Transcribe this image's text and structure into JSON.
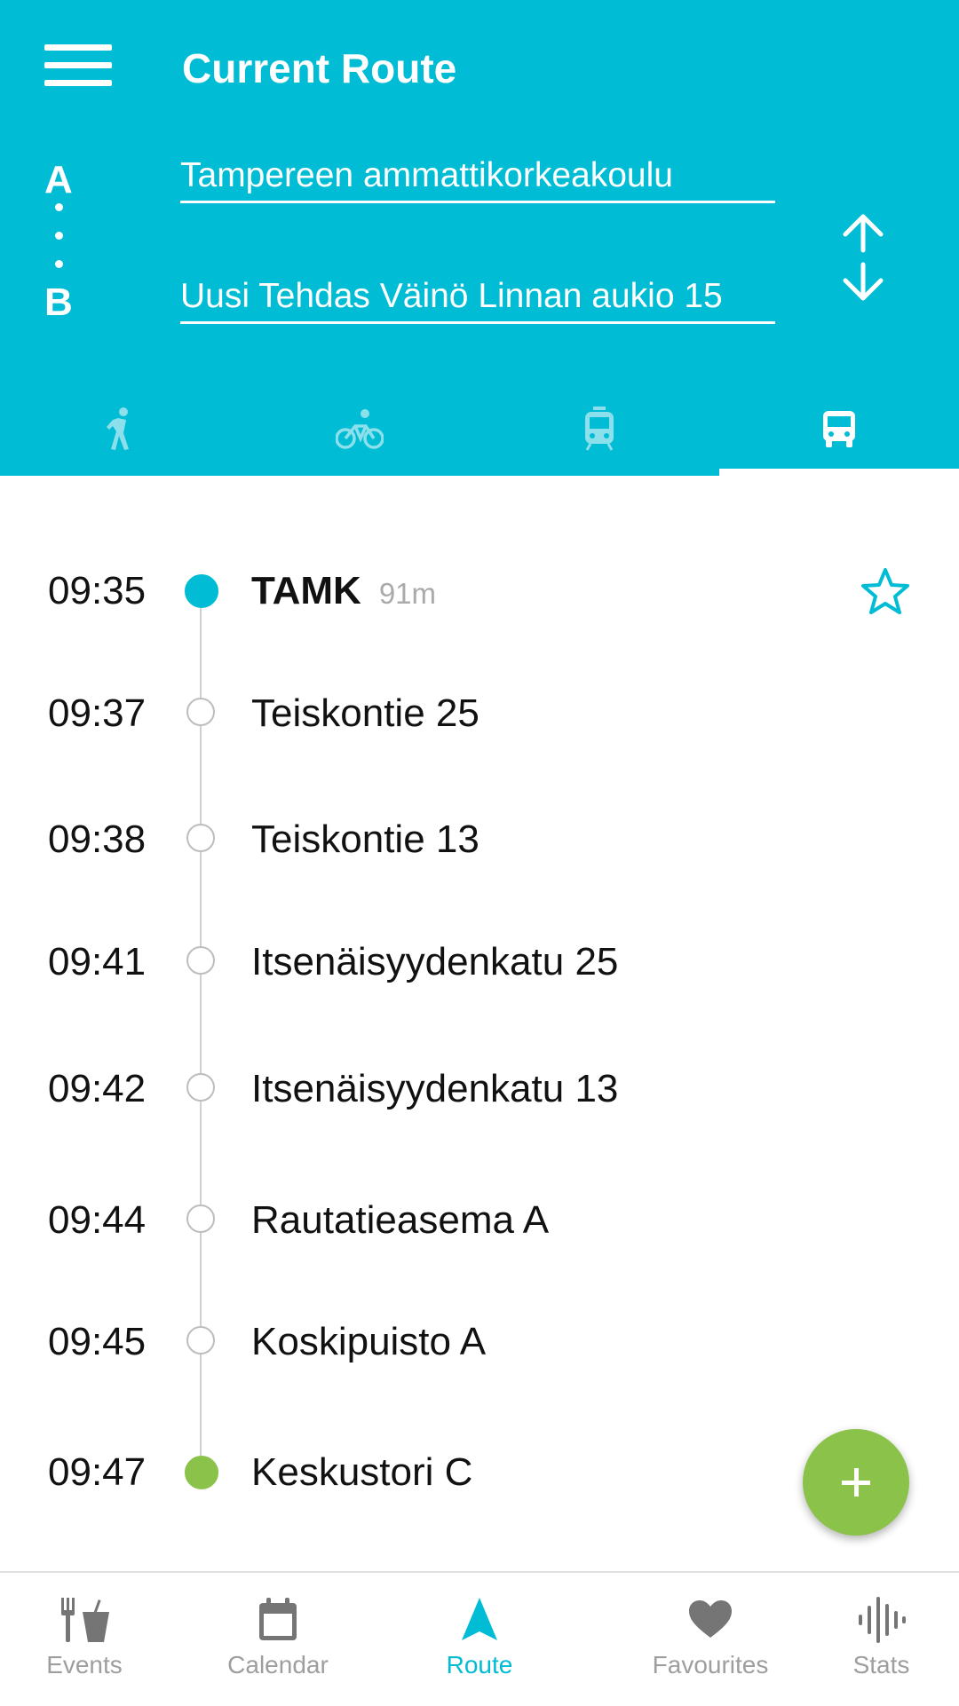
{
  "header": {
    "title": "Current Route",
    "from_letter": "A",
    "to_letter": "B",
    "from_value": "Tampereen ammattikorkeakoulu",
    "to_value": "Uusi Tehdas Väinö Linnan aukio 15",
    "bg_color": "#00BCD4"
  },
  "transport_modes": [
    {
      "icon": "walk-icon",
      "active": false
    },
    {
      "icon": "bicycle-icon",
      "active": false
    },
    {
      "icon": "tram-icon",
      "active": false
    },
    {
      "icon": "bus-icon",
      "active": true
    }
  ],
  "stops": [
    {
      "time": "09:35",
      "name": "TAMK",
      "distance": "91m",
      "type": "start"
    },
    {
      "time": "09:37",
      "name": "Teiskontie 25",
      "type": "mid"
    },
    {
      "time": "09:38",
      "name": "Teiskontie 13",
      "type": "mid"
    },
    {
      "time": "09:41",
      "name": "Itsenäisyydenkatu 25",
      "type": "mid"
    },
    {
      "time": "09:42",
      "name": "Itsenäisyydenkatu 13",
      "type": "mid"
    },
    {
      "time": "09:44",
      "name": "Rautatieasema A",
      "type": "mid"
    },
    {
      "time": "09:45",
      "name": "Koskipuisto A",
      "type": "mid"
    },
    {
      "time": "09:47",
      "name": "Keskustori C",
      "type": "end"
    }
  ],
  "nav": {
    "items": [
      {
        "label": "Events",
        "icon": "food-drink-icon",
        "active": false
      },
      {
        "label": "Calendar",
        "icon": "calendar-icon",
        "active": false
      },
      {
        "label": "Route",
        "icon": "navigation-arrow-icon",
        "active": true
      },
      {
        "label": "Favourites",
        "icon": "heart-icon",
        "active": false
      },
      {
        "label": "Stats",
        "icon": "audio-bars-icon",
        "active": false
      }
    ]
  },
  "colors": {
    "accent": "#00BCD4",
    "fab": "#8BC34A",
    "inactive": "#9e9e9e"
  }
}
